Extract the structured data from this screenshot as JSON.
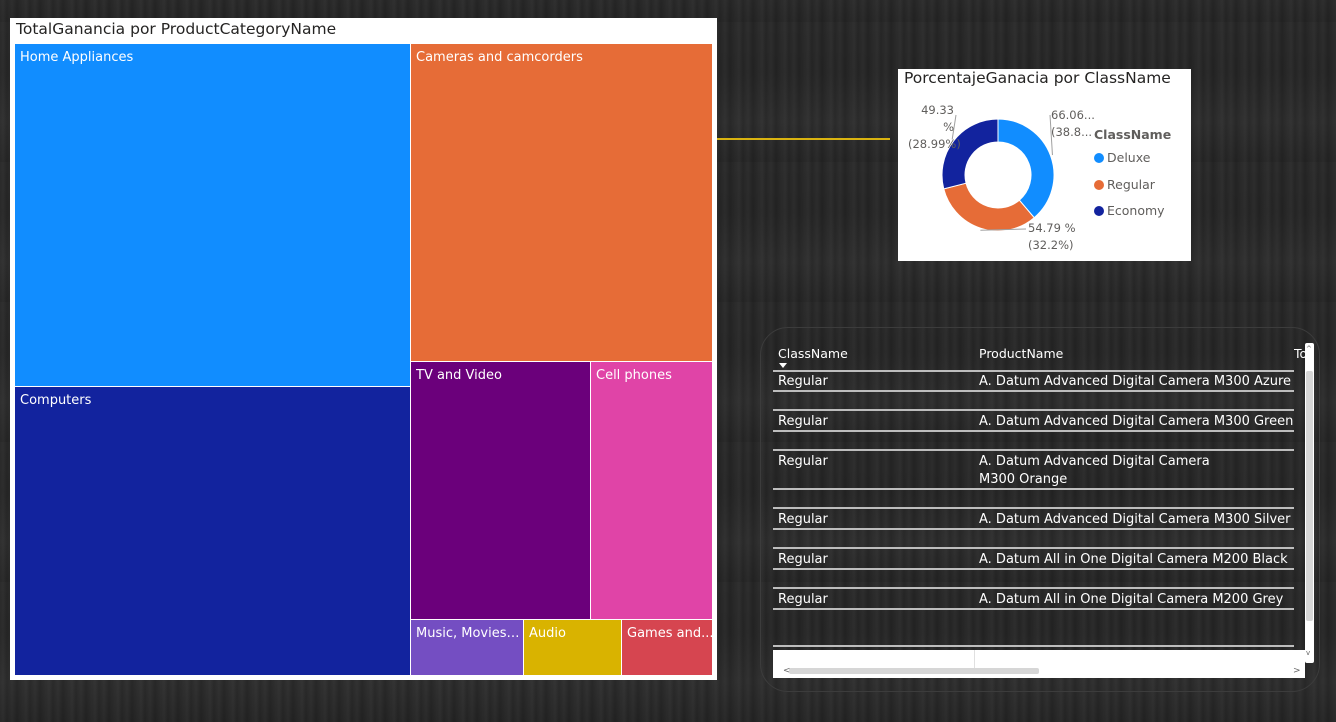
{
  "treemap": {
    "title": "TotalGanancia por ProductCategoryName",
    "tiles": [
      {
        "label": "Home Appliances",
        "color": "#118dff"
      },
      {
        "label": "Cameras and camcorders",
        "color": "#e66c37"
      },
      {
        "label": "Computers",
        "color": "#12239e"
      },
      {
        "label": "TV and Video",
        "color": "#6b007b"
      },
      {
        "label": "Cell phones",
        "color": "#e044a7"
      },
      {
        "label": "Music, Movies ...",
        "color": "#744ec2"
      },
      {
        "label": "Audio",
        "color": "#d9b300"
      },
      {
        "label": "Games and...",
        "color": "#d64550"
      }
    ]
  },
  "donut": {
    "title": "PorcentajeGanacia por ClassName",
    "legend_title": "ClassName",
    "labels": {
      "economy_pct": "49.33 %",
      "economy_share": "(28.99%)",
      "deluxe_pct": "66.06...",
      "deluxe_share": "(38.8...",
      "regular_pct": "54.79 %",
      "regular_share": "(32.2%)"
    },
    "legend": [
      {
        "name": "Deluxe",
        "color": "#118dff"
      },
      {
        "name": "Regular",
        "color": "#e66c37"
      },
      {
        "name": "Economy",
        "color": "#12239e"
      }
    ],
    "chart_data": {
      "type": "pie",
      "categories": [
        "Deluxe",
        "Regular",
        "Economy"
      ],
      "values": [
        66.06,
        54.79,
        49.33
      ],
      "shares": [
        38.8,
        32.2,
        28.99
      ]
    }
  },
  "table": {
    "headers": [
      "ClassName",
      "ProductName",
      "To"
    ],
    "rows": [
      {
        "class": "Regular",
        "product": "A. Datum Advanced Digital Camera M300 Azure"
      },
      {
        "class": "Regular",
        "product": "A. Datum Advanced Digital Camera M300 Green"
      },
      {
        "class": "Regular",
        "product": "A. Datum Advanced Digital Camera M300 Orange"
      },
      {
        "class": "Regular",
        "product": "A. Datum Advanced Digital Camera M300 Silver"
      },
      {
        "class": "Regular",
        "product": "A. Datum All in One Digital Camera M200 Black"
      },
      {
        "class": "Regular",
        "product": "A. Datum All in One Digital Camera M200 Grey"
      }
    ]
  },
  "colors": {
    "connector": "#d9b310",
    "header_text": "#ffffff"
  }
}
